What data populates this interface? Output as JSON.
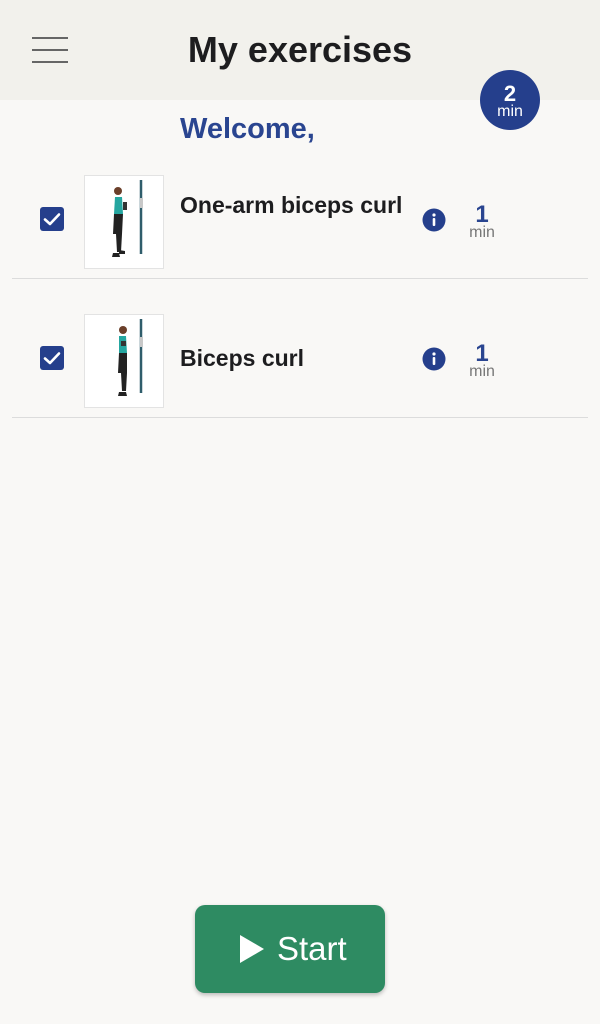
{
  "header": {
    "title": "My exercises",
    "menu_icon": "hamburger-menu-icon"
  },
  "total_duration": {
    "value": "2",
    "unit": "min"
  },
  "welcome_text": "Welcome,",
  "exercises": [
    {
      "name": "One-arm biceps curl",
      "checked": true,
      "duration": "1",
      "unit": "min",
      "info_icon": "info-icon"
    },
    {
      "name": "Biceps curl",
      "checked": true,
      "duration": "1",
      "unit": "min",
      "info_icon": "info-icon"
    }
  ],
  "start_button": {
    "label": "Start",
    "icon": "play-icon"
  },
  "colors": {
    "brand_blue": "#253f8c",
    "start_green": "#2e8b62",
    "background": "#f9f8f6",
    "header_bg": "#f2f1ec"
  }
}
